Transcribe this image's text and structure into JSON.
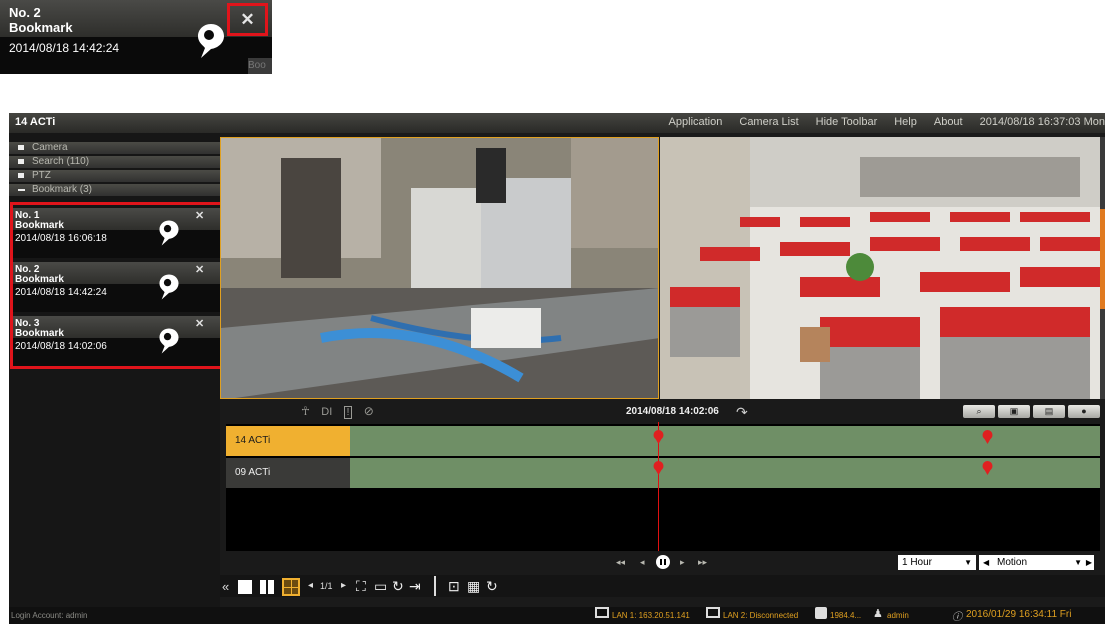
{
  "zoom_card": {
    "number": "No. 2",
    "type": "Bookmark",
    "datetime": "2014/08/18 14:42:24",
    "obscured_label": "Boo"
  },
  "app": {
    "title": "14 ACTi",
    "menu": [
      "Application",
      "Camera List",
      "Hide Toolbar",
      "Help",
      "About"
    ],
    "clock": "2014/08/18 16:37:03 Mon"
  },
  "sidebar": {
    "sections": [
      {
        "label": "Camera",
        "icon": "square-icon"
      },
      {
        "label": "Search (110)",
        "icon": "square-icon"
      },
      {
        "label": "PTZ",
        "icon": "square-icon"
      },
      {
        "label": "Bookmark (3)",
        "icon": "minus-icon"
      }
    ],
    "bookmarks": [
      {
        "number": "No. 1",
        "type": "Bookmark",
        "datetime": "2014/08/18 16:06:18"
      },
      {
        "number": "No. 2",
        "type": "Bookmark",
        "datetime": "2014/08/18 14:42:24"
      },
      {
        "number": "No. 3",
        "type": "Bookmark",
        "datetime": "2014/08/18 14:02:06"
      }
    ],
    "login": "Login Account: admin"
  },
  "timeline": {
    "tools": [
      "person-icon",
      "DI",
      "DO",
      "no-motion-icon"
    ],
    "current": "2014/08/18 14:02:06",
    "tracks": [
      {
        "name": "14 ACTi",
        "highlighted": true
      },
      {
        "name": "09 ACTi",
        "highlighted": false
      }
    ],
    "range": "1 Hour",
    "filter": "Motion"
  },
  "bottom_toolbar": {
    "page": "1/1",
    "collapse": "«"
  },
  "status": {
    "lan1": "LAN 1: 163.20.51.141",
    "lan2": "LAN 2: Disconnected",
    "storage": "1984.4...",
    "user": "admin",
    "datetime": "2016/01/29 16:34:11 Fri"
  },
  "colors": {
    "accent_orange": "#e0a020",
    "highlight_red": "#e0141b",
    "track_green": "#6f8f66",
    "track_selected": "#f0b030"
  }
}
